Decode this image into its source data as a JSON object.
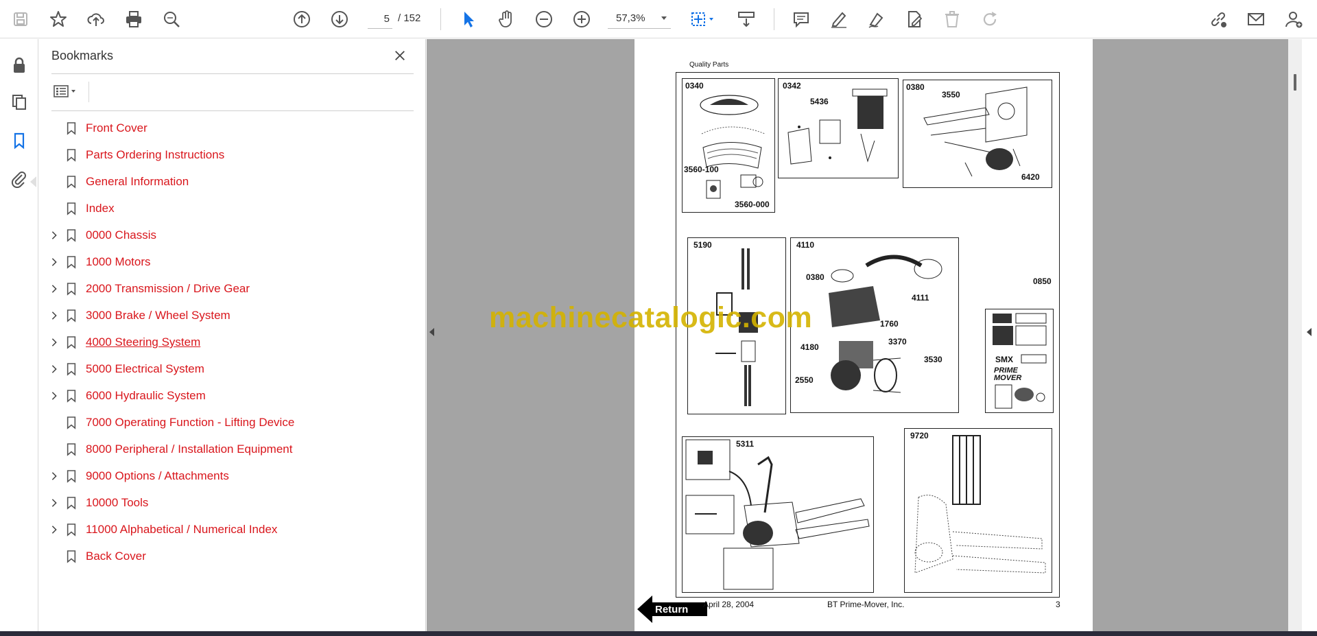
{
  "toolbar": {
    "page_current": "5",
    "page_total": "/  152",
    "zoom": "57,3%"
  },
  "bookmarks": {
    "title": "Bookmarks",
    "items": [
      {
        "label": "Front Cover",
        "expandable": false
      },
      {
        "label": "Parts Ordering Instructions",
        "expandable": false
      },
      {
        "label": "General Information",
        "expandable": false
      },
      {
        "label": "Index",
        "expandable": false
      },
      {
        "label": "0000 Chassis",
        "expandable": true
      },
      {
        "label": "1000 Motors",
        "expandable": true
      },
      {
        "label": "2000 Transmission / Drive Gear",
        "expandable": true
      },
      {
        "label": "3000 Brake / Wheel System",
        "expandable": true
      },
      {
        "label": "4000 Steering System ",
        "expandable": true,
        "hovered": true
      },
      {
        "label": "5000 Electrical System",
        "expandable": true
      },
      {
        "label": "6000 Hydraulic System",
        "expandable": true
      },
      {
        "label": "7000 Operating Function - Lifting Device",
        "expandable": false
      },
      {
        "label": "8000 Peripheral / Installation Equipment",
        "expandable": false
      },
      {
        "label": "9000 Options / Attachments",
        "expandable": true
      },
      {
        "label": "10000 Tools",
        "expandable": true
      },
      {
        "label": "11000 Alphabetical / Numerical Index",
        "expandable": true
      },
      {
        "label": "Back Cover",
        "expandable": false
      }
    ]
  },
  "document": {
    "header": "Quality Parts",
    "parts": {
      "p0340": "0340",
      "p3560_100": "3560-100",
      "p3560_000": "3560-000",
      "p0342": "0342",
      "p5436": "5436",
      "p0380": "0380",
      "p3550": "3550",
      "p6420": "6420",
      "p5190": "5190",
      "p4110": "4110",
      "p0380b": "0380",
      "p4111": "4111",
      "p1760": "1760",
      "p4180": "4180",
      "p3370": "3370",
      "p3530": "3530",
      "p2550": "2550",
      "p0850": "0850",
      "p5311": "5311",
      "p9720": "9720"
    },
    "label_smx": "SMX",
    "label_brand": "PRIME MOVER",
    "footer_date": "April 28, 2004",
    "footer_company": "BT Prime-Mover, Inc.",
    "footer_page": "3",
    "return_label": "Return"
  },
  "watermark": "machinecatalogic.com",
  "colors": {
    "bookmark_text": "#d9161c",
    "accent_blue": "#1473e6",
    "doc_background": "#a4a4a4",
    "watermark": "#d4b300"
  }
}
